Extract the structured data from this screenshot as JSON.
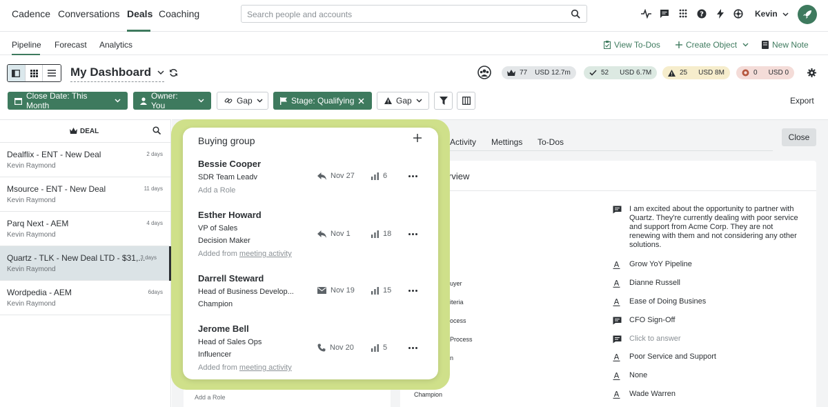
{
  "nav": {
    "items": [
      "Cadence",
      "Conversations",
      "Deals",
      "Coaching"
    ],
    "active": "Deals",
    "search_placeholder": "Search people and accounts",
    "user": "Kevin"
  },
  "subnav": {
    "items": [
      "Pipeline",
      "Forecast",
      "Analytics"
    ],
    "active": "Pipeline",
    "actions": [
      "View To-Dos",
      "Create Object",
      "New Note"
    ]
  },
  "dashboard": {
    "title": "My Dashboard",
    "stats": [
      {
        "count": "77",
        "amount": "USD 12.7m",
        "bg": "#e3e6e8"
      },
      {
        "count": "52",
        "amount": "USD 6.7M",
        "bg": "#dce9e2"
      },
      {
        "count": "25",
        "amount": "USD 8M",
        "bg": "#f6edcc"
      },
      {
        "count": "0",
        "amount": "USD 0",
        "bg": "#f4dcd8"
      }
    ]
  },
  "filters": {
    "close_date": "Close Date: This Month",
    "owner": "Owner: You",
    "gap1": "Gap",
    "stage": "Stage: Qualifying",
    "gap2": "Gap",
    "export": "Export"
  },
  "deals": {
    "header": "DEAL",
    "items": [
      {
        "name": "Dealflix - ENT - New Deal",
        "owner": "Kevin Raymond",
        "age": "2 days"
      },
      {
        "name": "Msource - ENT - New Deal",
        "owner": "Kevin Raymond",
        "age": "11 days"
      },
      {
        "name": "Parq Next - AEM",
        "owner": "Kevin Raymond",
        "age": "4 days"
      },
      {
        "name": "Quartz - TLK - New Deal LTD - $31,...",
        "owner": "Kevin Raymond",
        "age": "3 days"
      },
      {
        "name": "Wordpedia - AEM",
        "owner": "Kevin Raymond",
        "age": "6days"
      }
    ]
  },
  "detail": {
    "tabs": [
      "Activity",
      "Mettings",
      "To-Dos"
    ],
    "close": "Close",
    "overview_title": "rview",
    "left_labels": [
      "uyer",
      "iteria",
      "ocess",
      "Process",
      "n",
      "Champion"
    ],
    "lower_add_role": "Add a Role",
    "rows": [
      {
        "icon": "comment",
        "text": "I am excited about the opportunity to partner with Quartz. They're currently dealing with poor service and support from Acme Corp. They are not renewing with them and not considering any other solutions."
      },
      {
        "icon": "text",
        "text": "Grow YoY Pipeline"
      },
      {
        "icon": "text",
        "text": "Dianne Russell"
      },
      {
        "icon": "text",
        "text": "Ease of Doing Busines"
      },
      {
        "icon": "comment",
        "text": "CFO Sign-Off"
      },
      {
        "icon": "comment",
        "text": "Click to answer"
      },
      {
        "icon": "text",
        "text": "Poor Service and Support"
      },
      {
        "icon": "text",
        "text": "None"
      },
      {
        "icon": "text",
        "text": "Wade Warren"
      }
    ]
  },
  "buying_group": {
    "title": "Buying group",
    "people": [
      {
        "name": "Bessie Cooper",
        "title": "SDR Team Leadv",
        "role": "",
        "extra": "Add a Role",
        "extra_link": "",
        "activity_icon": "reply",
        "date": "Nov 27",
        "count": "6"
      },
      {
        "name": "Esther Howard",
        "title": "VP of Sales",
        "role": "Decision Maker",
        "extra": "Added from ",
        "extra_link": "meeting activity",
        "activity_icon": "reply",
        "date": "Nov 1",
        "count": "18"
      },
      {
        "name": "Darrell Steward",
        "title": "Head of Business Develop...",
        "role": "Champion",
        "extra": "",
        "extra_link": "",
        "activity_icon": "mail",
        "date": "Nov 19",
        "count": "15"
      },
      {
        "name": "Jerome Bell",
        "title": "Head of Sales Ops",
        "role": "Influencer",
        "extra": "Added from ",
        "extra_link": "meeting activity",
        "activity_icon": "phone",
        "date": "Nov 20",
        "count": "5"
      }
    ]
  },
  "colors": {
    "accent": "#3e7a5e",
    "highlight": "#cfe08a"
  }
}
